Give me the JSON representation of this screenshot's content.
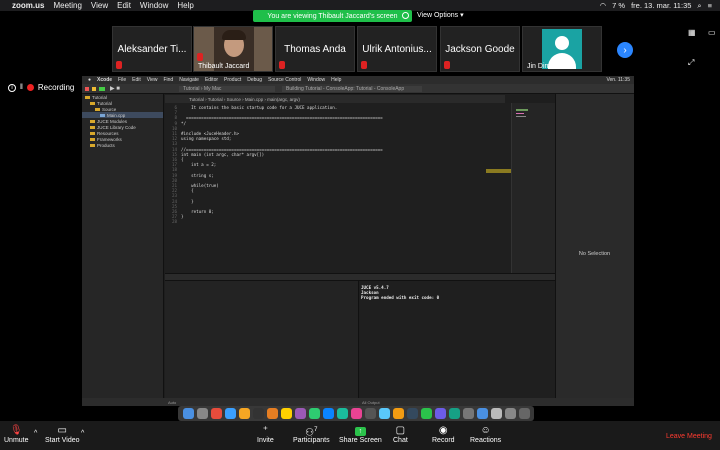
{
  "menubar": {
    "app": "zoom.us",
    "items": [
      "Meeting",
      "View",
      "Edit",
      "Window",
      "Help"
    ],
    "battery": "7 %",
    "datetime": "fre. 13. mar.  11:35"
  },
  "viewing": {
    "text": "You are viewing Thibault Jaccard's screen",
    "options": "View Options"
  },
  "participants": [
    {
      "name": "Aleksander Ti..."
    },
    {
      "name": "Thibault Jaccard",
      "video": true
    },
    {
      "name": "Thomas Anda"
    },
    {
      "name": "Ulrik Antonius..."
    },
    {
      "name": "Jackson Goode"
    },
    {
      "name": "Jin Dim",
      "avatar": true
    }
  ],
  "recording": "Recording",
  "xcode": {
    "menu": [
      "Xcode",
      "File",
      "Edit",
      "View",
      "Find",
      "Navigate",
      "Editor",
      "Product",
      "Debug",
      "Source Control",
      "Window",
      "Help"
    ],
    "right": "Ven. 11:35",
    "scheme": "Tutorial › My Mac",
    "status": "Building Tutorial - ConsoleApp: Tutorial - ConsoleApp",
    "breadcrumb": "Tutorial › Tutorial › Source › Main.cpp › main(argc, argv)",
    "nav": [
      {
        "label": "Tutorial",
        "indent": 0
      },
      {
        "label": "Tutorial",
        "indent": 1
      },
      {
        "label": "Source",
        "indent": 2
      },
      {
        "label": "Main.cpp",
        "indent": 3,
        "selected": true
      },
      {
        "label": "JUCE Modules",
        "indent": 1
      },
      {
        "label": "JUCE Library Code",
        "indent": 1
      },
      {
        "label": "Resources",
        "indent": 1
      },
      {
        "label": "Frameworks",
        "indent": 1
      },
      {
        "label": "Products",
        "indent": 1
      }
    ],
    "code": [
      {
        "n": "6",
        "t": "    It contains the basic startup code for a JUCE application.",
        "c": "cmt"
      },
      {
        "n": "7",
        "t": "",
        "c": ""
      },
      {
        "n": "8",
        "t": "  ==============================================================================",
        "c": "cmt"
      },
      {
        "n": "9",
        "t": "*/",
        "c": "cmt"
      },
      {
        "n": "10",
        "t": "",
        "c": ""
      },
      {
        "n": "11",
        "t": "#include <JuceHeader.h>",
        "c": "pp"
      },
      {
        "n": "12",
        "t": "using namespace std;",
        "c": "kw"
      },
      {
        "n": "13",
        "t": "",
        "c": ""
      },
      {
        "n": "14",
        "t": "//==============================================================================",
        "c": "cmt"
      },
      {
        "n": "15",
        "t": "int main (int argc, char* argv[])",
        "c": "ty"
      },
      {
        "n": "16",
        "t": "{",
        "c": ""
      },
      {
        "n": "17",
        "t": "    int a = 2;",
        "c": ""
      },
      {
        "n": "18",
        "t": "",
        "c": ""
      },
      {
        "n": "19",
        "t": "    string s;",
        "c": ""
      },
      {
        "n": "20",
        "t": "",
        "c": ""
      },
      {
        "n": "21",
        "t": "    while(true)",
        "c": ""
      },
      {
        "n": "22",
        "t": "    {",
        "c": ""
      },
      {
        "n": "23",
        "t": "",
        "c": ""
      },
      {
        "n": "24",
        "t": "    }",
        "c": ""
      },
      {
        "n": "25",
        "t": "",
        "c": ""
      },
      {
        "n": "26",
        "t": "    return 0;",
        "c": ""
      },
      {
        "n": "27",
        "t": "}",
        "c": ""
      },
      {
        "n": "28",
        "t": "",
        "c": ""
      }
    ],
    "inspector": "No Selection",
    "console": [
      "JUCE v5.4.7",
      "Jackson",
      "Program ended with exit code: 0"
    ],
    "filter_left": "Auto",
    "filter_right": "All Output"
  },
  "toolbar": {
    "unmute": "Unmute",
    "start_video": "Start Video",
    "invite": "Invite",
    "participants": "Participants",
    "participants_count": "7",
    "share": "Share Screen",
    "chat": "Chat",
    "record": "Record",
    "reactions": "Reactions",
    "leave": "Leave Meeting"
  }
}
